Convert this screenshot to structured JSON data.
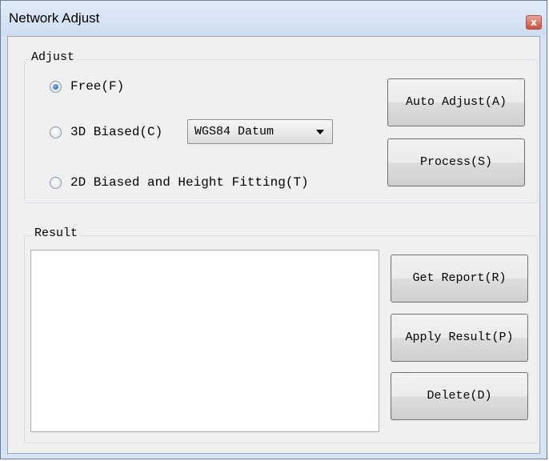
{
  "window": {
    "title": "Network Adjust",
    "close_glyph": "x"
  },
  "adjust_group": {
    "label": "Adjust",
    "options": [
      {
        "label": "Free(F)",
        "checked": true
      },
      {
        "label": "3D Biased(C)",
        "checked": false
      },
      {
        "label": "2D Biased and Height Fitting(T)",
        "checked": false
      }
    ],
    "datum_select": {
      "value": "WGS84 Datum"
    },
    "buttons": {
      "auto_adjust": "Auto Adjust(A)",
      "process": "Process(S)"
    }
  },
  "result_group": {
    "label": "Result",
    "text": "",
    "buttons": {
      "get_report": "Get Report(R)",
      "apply_result": "Apply Result(P)",
      "delete": "Delete(D)"
    }
  }
}
